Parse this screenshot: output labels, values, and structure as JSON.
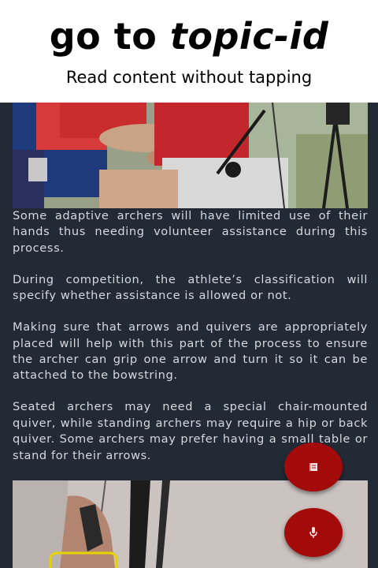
{
  "banner": {
    "title_plain": "go to ",
    "title_emphasis": "topic-id",
    "subtitle": "Read content without tapping"
  },
  "article": {
    "paragraphs": [
      "Some adaptive archers will have limited use of their hands thus needing volunteer assistance during this process.",
      "During competition, the athlete’s classification will specify whether assistance is allowed or not.",
      "Making sure that arrows and quivers are appropriately placed will help with this part of the process to ensure the archer can grip one arrow and turn it so it can be attached to the bowstring.",
      "Seated archers may need a special chair-mounted quiver, while standing archers may require a hip or back quiver. Some archers may prefer having a small table or stand for their arrows."
    ]
  },
  "fabs": {
    "read_icon": "book-icon",
    "voice_icon": "microphone-icon"
  },
  "colors": {
    "background": "#222a36",
    "text": "#d5d8de",
    "fab": "#a30a0a",
    "highlight": "#e5d300"
  }
}
